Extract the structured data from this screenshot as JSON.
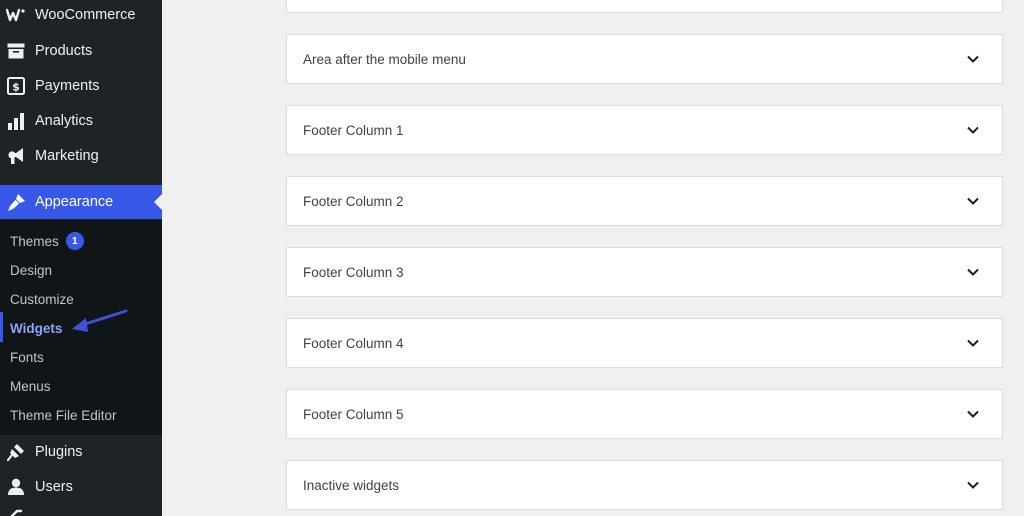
{
  "sidebar": {
    "menu": [
      {
        "label": "WooCommerce",
        "icon": "woocommerce-icon"
      },
      {
        "label": "Products",
        "icon": "products-archive-icon"
      },
      {
        "label": "Payments",
        "icon": "payments-dollar-icon"
      },
      {
        "label": "Analytics",
        "icon": "analytics-bar-chart-icon"
      },
      {
        "label": "Marketing",
        "icon": "megaphone-icon"
      },
      {
        "label": "Appearance",
        "icon": "paintbrush-icon"
      },
      {
        "label": "Plugins",
        "icon": "plugins-icon"
      },
      {
        "label": "Users",
        "icon": "users-icon"
      }
    ],
    "appearance_submenu": [
      {
        "label": "Themes",
        "badge": "1"
      },
      {
        "label": "Design"
      },
      {
        "label": "Customize"
      },
      {
        "label": "Widgets"
      },
      {
        "label": "Fonts"
      },
      {
        "label": "Menus"
      },
      {
        "label": "Theme File Editor"
      }
    ],
    "active_menu": "Appearance",
    "current_submenu": "Widgets",
    "accent_color": "#3858e9",
    "background_color": "#1d2327"
  },
  "main": {
    "widget_areas": [
      {
        "title": ""
      },
      {
        "title": "Area after the mobile menu"
      },
      {
        "title": "Footer Column 1"
      },
      {
        "title": "Footer Column 2"
      },
      {
        "title": "Footer Column 3"
      },
      {
        "title": "Footer Column 4"
      },
      {
        "title": "Footer Column 5"
      },
      {
        "title": "Inactive widgets"
      }
    ],
    "expand_icon": "chevron-down-icon"
  }
}
